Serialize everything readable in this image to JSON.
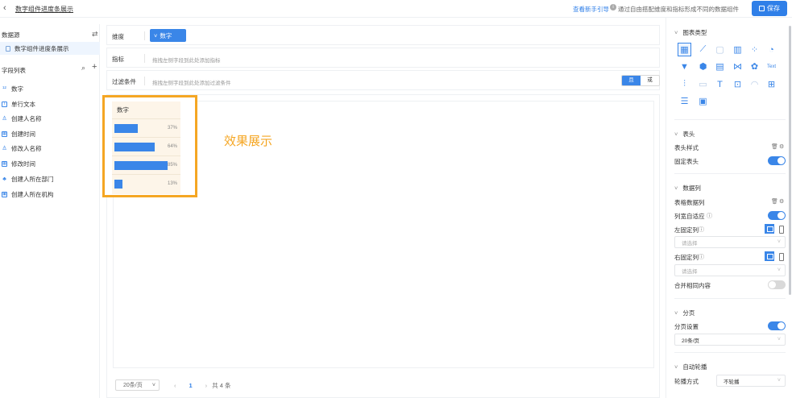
{
  "header": {
    "title": "数字组件进度条展示",
    "guide_link": "查看新手引导",
    "guide_text": "通过自由搭配维度和指标形成不同的数据组件",
    "save_label": "保存"
  },
  "left": {
    "datasource_label": "数据源",
    "datasource_item": "数字组件进度条展示",
    "field_list_label": "字段列表",
    "fields": [
      {
        "icon": "number-icon",
        "label": "数字"
      },
      {
        "icon": "text-icon",
        "label": "单行文本"
      },
      {
        "icon": "user-icon",
        "label": "创建人名称"
      },
      {
        "icon": "calendar-icon",
        "label": "创建时间"
      },
      {
        "icon": "user-icon",
        "label": "修改人名称"
      },
      {
        "icon": "calendar-icon",
        "label": "修改时间"
      },
      {
        "icon": "org-icon",
        "label": "创建人所在部门"
      },
      {
        "icon": "org-box-icon",
        "label": "创建人所在机构"
      }
    ]
  },
  "config": {
    "dimension_label": "维度",
    "dimension_tag": "数字",
    "metric_label": "指标",
    "metric_hint": "拖拽左侧字段到此处添加指标",
    "filter_label": "过滤条件",
    "filter_hint": "拖拽左侧字段到此处添加过滤条件",
    "and_label": "且",
    "or_label": "或"
  },
  "preview": {
    "column_header": "数字",
    "rows": [
      {
        "label": "37%",
        "progress": 0.37
      },
      {
        "label": "64%",
        "progress": 0.64
      },
      {
        "label": "85%",
        "progress": 0.85
      },
      {
        "label": "13%",
        "progress": 0.13
      }
    ],
    "effect_label": "效果展示"
  },
  "pager": {
    "page_size": "20条/页",
    "current_page": "1",
    "total": "共 4 条"
  },
  "right": {
    "chart_type_title": "图表类型",
    "chart_types": [
      "table-icon",
      "line-chart-icon",
      "number-card-icon",
      "bar-chart-icon",
      "scatter-icon",
      "pie-chart-icon",
      "funnel-icon",
      "radar-icon",
      "stacked-bar-icon",
      "dual-axis-icon",
      "map-icon",
      "text-icon",
      "bar-line-icon",
      "gantt-icon",
      "title-icon",
      "image-card-icon",
      "gauge-icon",
      "pivot-table-icon",
      "rank-icon",
      "picture-icon"
    ],
    "header_section": "表头",
    "header_style": "表头样式",
    "fixed_header": "固定表头",
    "data_column_section": "数据列",
    "table_data_column": "表格数据列",
    "column_adaptive": "列宽自适应",
    "left_fixed": "左固定列",
    "right_fixed": "右固定列",
    "select_placeholder": "请选择",
    "merge_same": "合并相同内容",
    "paging_section": "分页",
    "paging_setting": "分页设置",
    "paging_value": "20条/页",
    "carousel_section": "自动轮播",
    "carousel_mode": "轮播方式",
    "carousel_value": "不轮播"
  }
}
